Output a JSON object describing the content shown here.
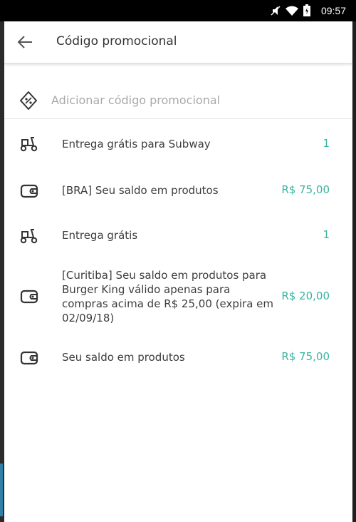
{
  "status_bar": {
    "time": "09:57",
    "icons": [
      "mute-icon",
      "wifi-icon",
      "battery-icon"
    ]
  },
  "header": {
    "title": "Código promocional"
  },
  "promo_input": {
    "placeholder": "Adicionar código promocional"
  },
  "items": [
    {
      "icon": "scooter-icon",
      "label": "Entrega grátis para Subway",
      "value": "1"
    },
    {
      "icon": "wallet-icon",
      "label": "[BRA] Seu saldo em produtos",
      "value": "R$ 75,00"
    },
    {
      "icon": "scooter-icon",
      "label": "Entrega grátis",
      "value": "1"
    },
    {
      "icon": "wallet-icon",
      "label": "[Curitiba] Seu saldo em produtos para Burger King válido apenas para compras acima de R$ 25,00 (expira em 02/09/18)",
      "value": "R$ 20,00"
    },
    {
      "icon": "wallet-icon",
      "label": "Seu saldo em produtos",
      "value": "R$ 75,00"
    }
  ],
  "colors": {
    "accent": "#39b4a0",
    "text": "#3d3d3d",
    "placeholder": "#a9a9a9"
  }
}
